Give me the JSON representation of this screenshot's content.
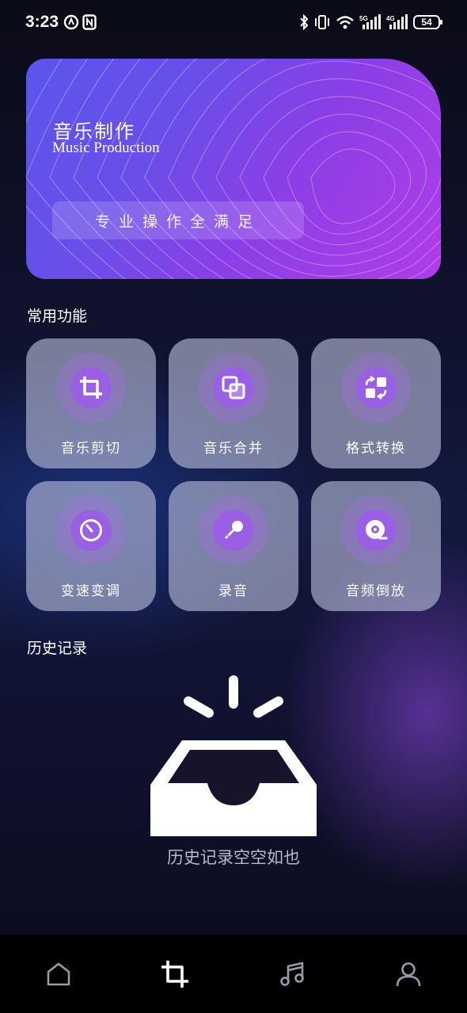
{
  "status_bar": {
    "time": "3:23",
    "battery": "54"
  },
  "banner": {
    "title": "音乐制作",
    "subtitle": "Music Production",
    "slogan": "专业操作全满足"
  },
  "sections": {
    "common_functions": "常用功能",
    "history": "历史记录"
  },
  "functions": [
    {
      "label": "音乐剪切",
      "icon": "crop-icon"
    },
    {
      "label": "音乐合并",
      "icon": "merge-icon"
    },
    {
      "label": "格式转换",
      "icon": "convert-icon"
    },
    {
      "label": "变速变调",
      "icon": "speed-dial-icon"
    },
    {
      "label": "录音",
      "icon": "microphone-icon"
    },
    {
      "label": "音频倒放",
      "icon": "disc-reverse-icon"
    }
  ],
  "history_empty_text": "历史记录空空如也",
  "tab_bar": {
    "items": [
      {
        "icon": "home-icon",
        "active": false
      },
      {
        "icon": "crop-icon",
        "active": true
      },
      {
        "icon": "music-note-icon",
        "active": false
      },
      {
        "icon": "user-icon",
        "active": false
      }
    ]
  },
  "colors": {
    "accent": "#9a60e4",
    "banner_start": "#5a56ee",
    "banner_end": "#b13ce8",
    "tabbar_bg": "#000000"
  }
}
